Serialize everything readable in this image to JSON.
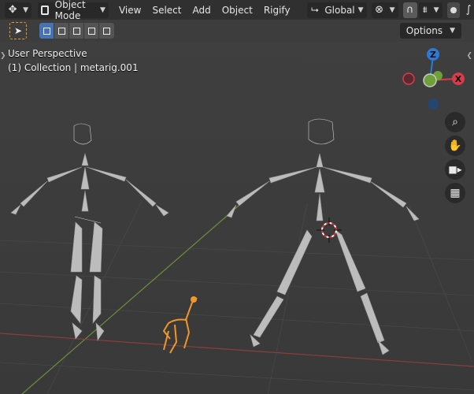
{
  "header": {
    "mode_label": "Object Mode",
    "menus": [
      "View",
      "Select",
      "Add",
      "Object",
      "Rigify"
    ],
    "orientation_label": "Global"
  },
  "toolbar": {
    "options_label": "Options"
  },
  "viewport": {
    "view_name": "User Perspective",
    "collection_info": "(1) Collection | metarig.001"
  },
  "gizmo": {
    "z_label": "Z",
    "x_label": "X",
    "colors": {
      "z": "#2e78d6",
      "x": "#d83b4b",
      "y": "#6ea13a"
    }
  },
  "nav_icons": [
    "zoom-icon",
    "pan-hand-icon",
    "camera-icon",
    "grid-projection-icon"
  ]
}
